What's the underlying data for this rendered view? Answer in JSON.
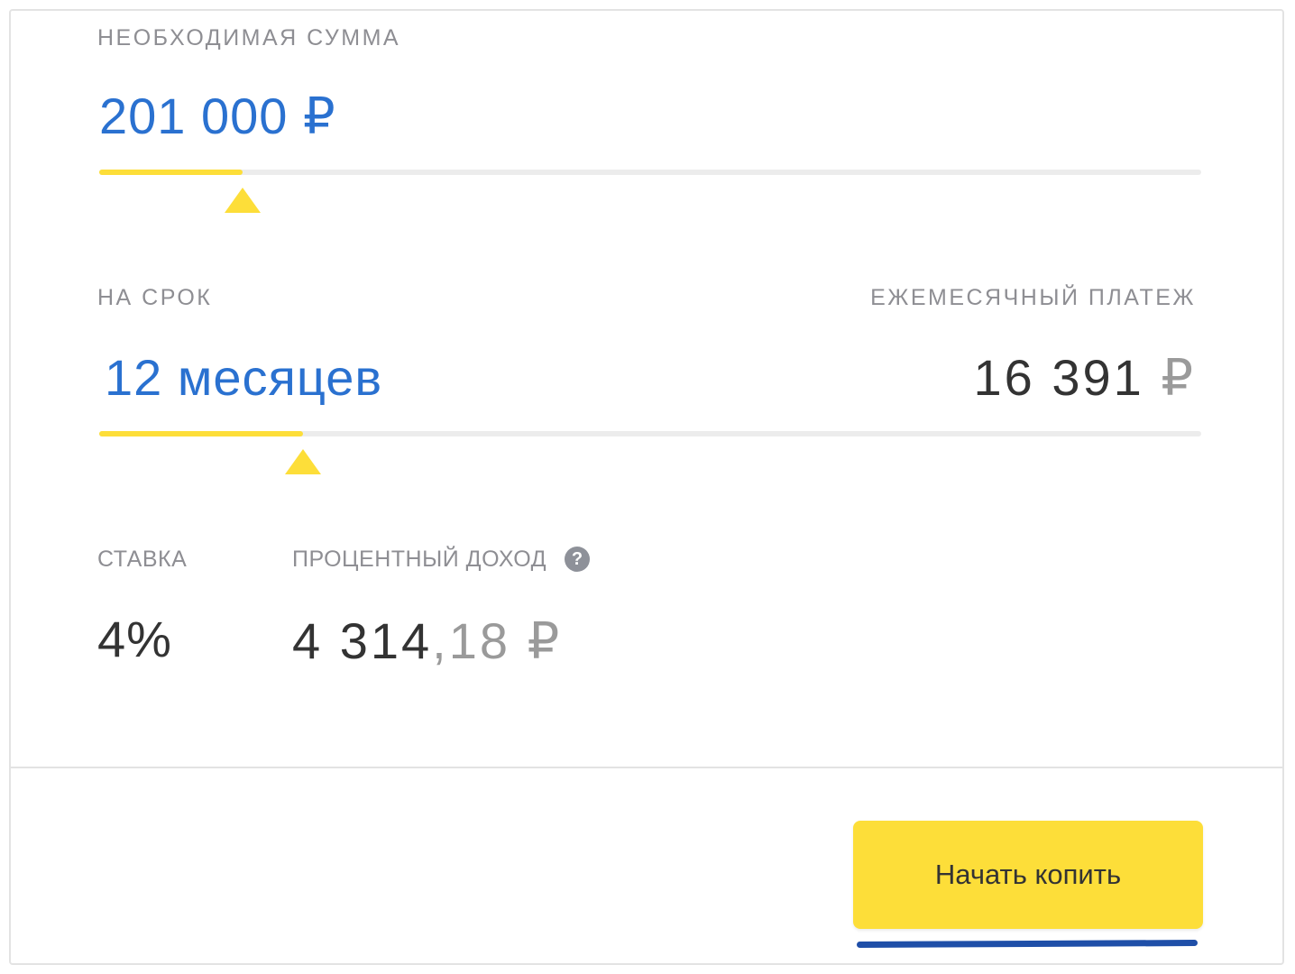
{
  "amount": {
    "label": "НЕОБХОДИМАЯ СУММА",
    "value": "201 000 ₽",
    "slider_fill_fraction": 0.13
  },
  "term": {
    "label": "НА СРОК",
    "value": "12 месяцев",
    "slider_fill_fraction": 0.185
  },
  "monthly_payment": {
    "label": "ЕЖЕМЕСЯЧНЫЙ ПЛАТЕЖ",
    "number": "16 391",
    "currency": "₽"
  },
  "rate": {
    "label": "СТАВКА",
    "value": "4%"
  },
  "interest_income": {
    "label": "ПРОЦЕНТНЫЙ ДОХОД",
    "integer_part": "4 314",
    "fraction_part": ",18",
    "currency": "₽",
    "help_icon": "question-circle-icon",
    "help_glyph": "?"
  },
  "action": {
    "button_label": "Начать копить"
  },
  "colors": {
    "accent_yellow": "#fdde39",
    "value_blue": "#2a71d0",
    "underline_blue": "#1f4fa8"
  }
}
